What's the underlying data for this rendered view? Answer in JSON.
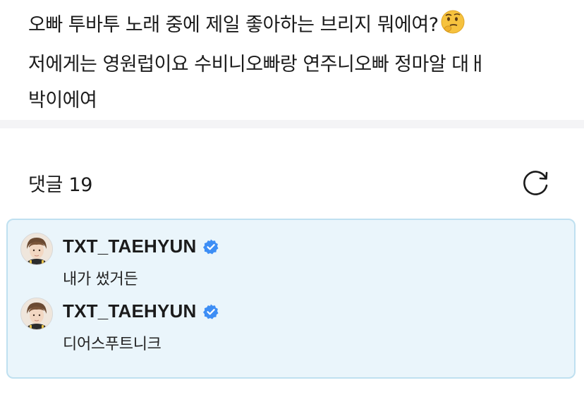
{
  "post": {
    "lines": [
      "오빠 투바투 노래 중에 제일 좋아하는 브리지 뭐에여?",
      "저에게는 영원럽이요 수비니오빠랑 연주니오빠 정마알 대ㅐ",
      "박이에여"
    ],
    "emoji": "thinking-face-emoji"
  },
  "comments_section": {
    "title": "댓글 19",
    "refresh_icon": "refresh-icon"
  },
  "replies": [
    {
      "author": "TXT_TAEHYUN",
      "verified": true,
      "text": "내가 썼거든"
    },
    {
      "author": "TXT_TAEHYUN",
      "verified": true,
      "text": "디어스푸트니크"
    }
  ],
  "colors": {
    "highlight_bg": "#eaf5fb",
    "highlight_border": "#bfe0f0",
    "verified_blue": "#3d8ef5",
    "separator": "#f4f4f6"
  }
}
